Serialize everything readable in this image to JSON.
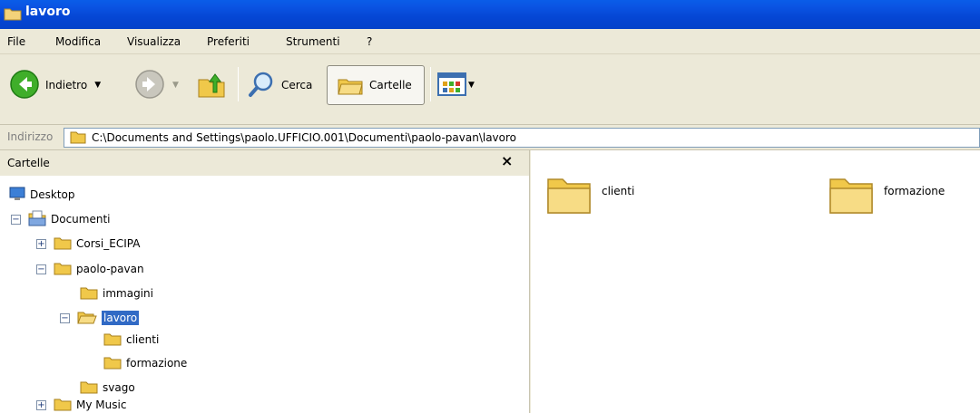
{
  "window": {
    "title": "lavoro"
  },
  "menu": [
    "File",
    "Modifica",
    "Visualizza",
    "Preferiti",
    "Strumenti",
    "?"
  ],
  "toolbar": {
    "back_label": "Indietro",
    "search_label": "Cerca",
    "folders_label": "Cartelle"
  },
  "address": {
    "label": "Indirizzo",
    "path": "C:\\Documents and Settings\\paolo.UFFICIO.001\\Documenti\\paolo-pavan\\lavoro"
  },
  "tree": {
    "title": "Cartelle",
    "close": "×",
    "items": [
      {
        "label": "Desktop",
        "expander": "",
        "icon": "desktop-icon"
      },
      {
        "label": "Documenti",
        "expander": "−",
        "icon": "documents-icon"
      },
      {
        "label": "Corsi_ECIPA",
        "expander": "+",
        "icon": "folder-icon"
      },
      {
        "label": "paolo-pavan",
        "expander": "−",
        "icon": "folder-icon"
      },
      {
        "label": "immagini",
        "expander": "",
        "icon": "folder-icon"
      },
      {
        "label": "lavoro",
        "expander": "−",
        "icon": "folder-open-icon",
        "selected": true
      },
      {
        "label": "clienti",
        "expander": "",
        "icon": "folder-icon"
      },
      {
        "label": "formazione",
        "expander": "",
        "icon": "folder-icon"
      },
      {
        "label": "svago",
        "expander": "",
        "icon": "folder-icon"
      },
      {
        "label": "My Music",
        "expander": "+",
        "icon": "folder-icon"
      }
    ]
  },
  "content": {
    "items": [
      {
        "label": "clienti",
        "icon": "folder-large-icon"
      },
      {
        "label": "formazione",
        "icon": "folder-large-icon"
      }
    ]
  },
  "colors": {
    "titlebar": "#0546d4",
    "selection": "#316ac5",
    "chrome": "#ece9d8"
  }
}
